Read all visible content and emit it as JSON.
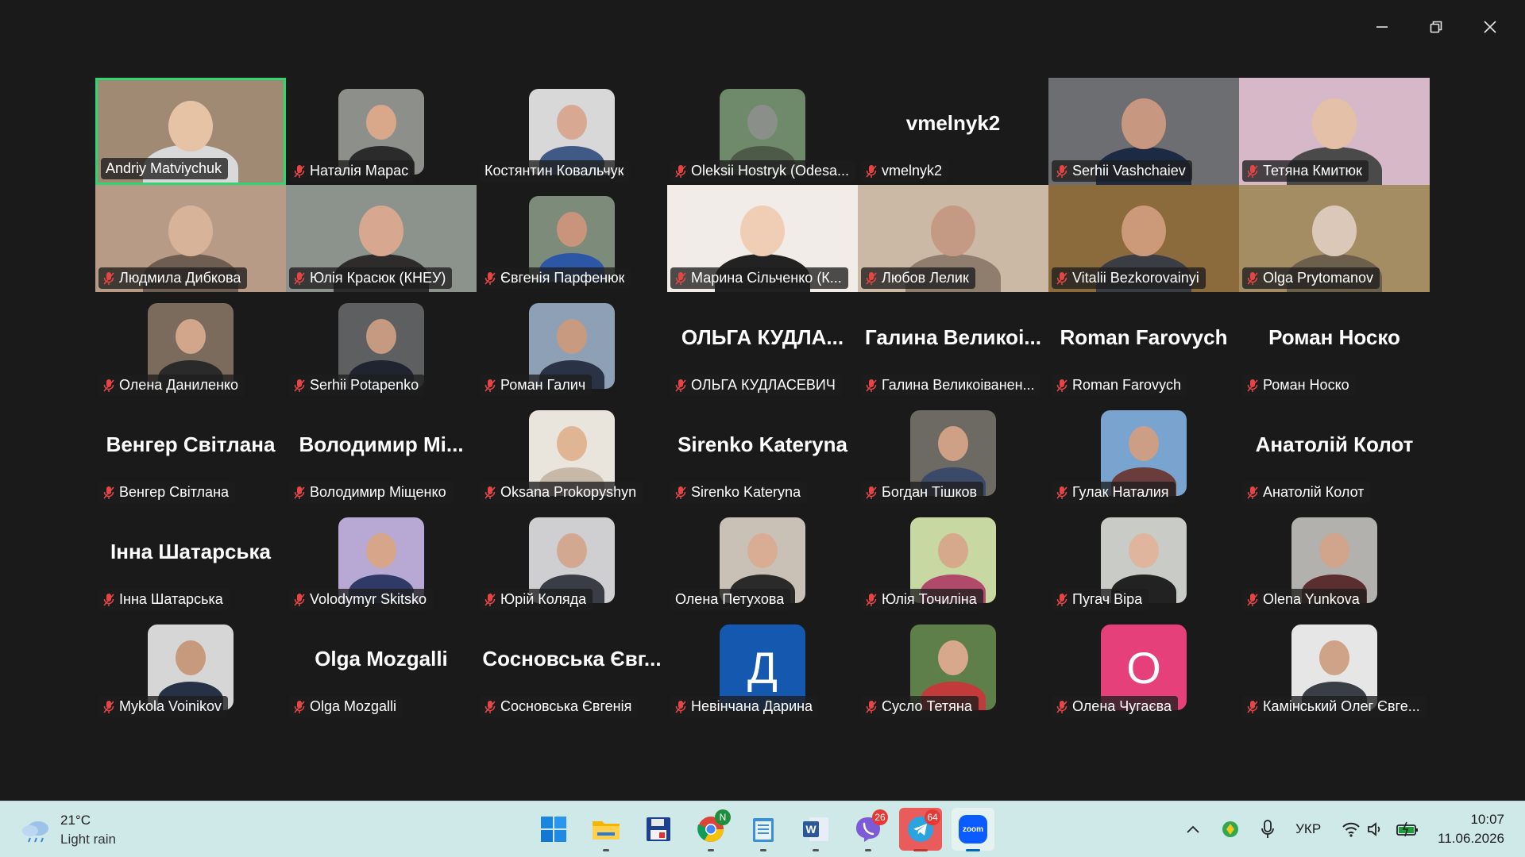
{
  "window_controls": {
    "minimize": "minimize",
    "restore": "restore",
    "close": "close"
  },
  "participants": [
    {
      "name": "Andriy Matviychuk",
      "mode": "full",
      "active": true,
      "muted": false,
      "bg": "#a08a74",
      "skin": "#e6c3a4",
      "shirt": "#d9d9d9"
    },
    {
      "name": "Наталія Марас",
      "mode": "thumb",
      "muted": true,
      "bg": "#8d8f8a",
      "skin": "#d9a88a",
      "shirt": "#2b2b2b"
    },
    {
      "name": "Костянтин Ковальчук",
      "mode": "thumb",
      "muted": false,
      "bg": "#d8d8d8",
      "skin": "#d9a892",
      "shirt": "#3f5a84"
    },
    {
      "name": "Oleksii Hostryk (Odesa...",
      "mode": "thumb",
      "muted": true,
      "bg": "#6f8a6a",
      "skin": "#8a8f8a",
      "shirt": "#4d5a48"
    },
    {
      "name": "vmelnyk2",
      "big": "vmelnyk2",
      "mode": "text",
      "muted": true
    },
    {
      "name": "Serhii Vashchaiev",
      "mode": "full",
      "muted": true,
      "bg": "#6d6e72",
      "skin": "#c89780",
      "shirt": "#1c2a44"
    },
    {
      "name": "Тетяна Кмитюк",
      "mode": "full",
      "muted": true,
      "bg": "#d7b8c9",
      "skin": "#e4c0a8",
      "shirt": "#4a4a4a"
    },
    {
      "name": "Людмила Дибкова",
      "mode": "full",
      "muted": true,
      "bg": "#b89b86",
      "skin": "#d7b39a",
      "shirt": "#6e5e52"
    },
    {
      "name": "Юлія Красюк (КНЕУ)",
      "mode": "full",
      "muted": true,
      "bg": "#8c938d",
      "skin": "#d7a88f",
      "shirt": "#2e2b2b"
    },
    {
      "name": "Євгенія Парфенюк",
      "mode": "thumb",
      "muted": true,
      "bg": "#7c8b7a",
      "skin": "#c8957c",
      "shirt": "#2b57a6"
    },
    {
      "name": "Марина Сільченко (К...",
      "mode": "full",
      "muted": true,
      "bg": "#f2ece8",
      "skin": "#f0cdb5",
      "shirt": "#222"
    },
    {
      "name": "Любов Лелик",
      "mode": "full",
      "muted": true,
      "bg": "#cbb8a5",
      "skin": "#c49a84",
      "shirt": "#8f7d6d"
    },
    {
      "name": "Vitalii Bezkorovainyi",
      "mode": "full",
      "muted": true,
      "bg": "#8b6a3b",
      "skin": "#cc9a78",
      "shirt": "#3b3d44"
    },
    {
      "name": "Olga Prytomanov",
      "mode": "full",
      "muted": true,
      "bg": "#a48d63",
      "skin": "#dcc8b8",
      "shirt": "#6c5f4c"
    },
    {
      "name": "Олена Даниленко",
      "mode": "thumb",
      "muted": true,
      "bg": "#7a6b5c",
      "skin": "#d2a68a",
      "shirt": "#2a2a2a"
    },
    {
      "name": "Serhii Potapenko",
      "mode": "thumb",
      "muted": true,
      "bg": "#5e5f60",
      "skin": "#c69a80",
      "shirt": "#1f2430"
    },
    {
      "name": "Роман Галич",
      "mode": "thumb",
      "muted": true,
      "bg": "#8ea0b6",
      "skin": "#c89a80",
      "shirt": "#2a3346"
    },
    {
      "name": "ОЛЬГА КУДЛАСЕВИЧ",
      "big": "ОЛЬГА КУДЛА...",
      "mode": "text",
      "muted": true
    },
    {
      "name": "Галина Великоіванен...",
      "big": "Галина Великоі...",
      "mode": "text",
      "muted": true
    },
    {
      "name": "Roman Farovych",
      "big": "Roman Farovych",
      "mode": "text",
      "muted": true
    },
    {
      "name": "Роман Носко",
      "big": "Роман Носко",
      "mode": "text",
      "muted": true
    },
    {
      "name": "Венгер Світлана",
      "big": "Венгер Світлана",
      "mode": "text",
      "muted": true
    },
    {
      "name": "Володимир Міщенко",
      "big": "Володимир Мі...",
      "mode": "text",
      "muted": true
    },
    {
      "name": "Oksana Prokopyshyn",
      "mode": "thumb",
      "muted": true,
      "bg": "#e9e4dc",
      "skin": "#e0b594",
      "shirt": "#c7b8a8"
    },
    {
      "name": "Sirenko Kateryna",
      "big": "Sirenko Kateryna",
      "mode": "text",
      "muted": true
    },
    {
      "name": "Богдан Тішков",
      "mode": "thumb",
      "muted": true,
      "bg": "#6d6a64",
      "skin": "#cfa085",
      "shirt": "#3c4a6a"
    },
    {
      "name": "Гулак Наталия",
      "mode": "thumb",
      "muted": true,
      "bg": "#79a4cf",
      "skin": "#cd9e86",
      "shirt": "#6a3c3c"
    },
    {
      "name": "Анатолій Колот",
      "big": "Анатолій Колот",
      "mode": "text",
      "muted": true
    },
    {
      "name": "Інна Шатарська",
      "big": "Інна Шатарська",
      "mode": "text",
      "muted": true
    },
    {
      "name": "Volodymyr Skitsko",
      "mode": "thumb",
      "muted": true,
      "bg": "#b7a9d4",
      "skin": "#d6a58a",
      "shirt": "#2f3a66"
    },
    {
      "name": "Юрій Коляда",
      "mode": "thumb",
      "muted": true,
      "bg": "#cfcfd2",
      "skin": "#d3a891",
      "shirt": "#3a3d45"
    },
    {
      "name": "Олена Петухова",
      "mode": "thumb",
      "muted": false,
      "bg": "#c9c1b5",
      "skin": "#d9ad93",
      "shirt": "#2a2a2a"
    },
    {
      "name": "Юлія Точиліна",
      "mode": "thumb",
      "muted": true,
      "bg": "#c7d8a3",
      "skin": "#d7a98c",
      "shirt": "#b04a6a"
    },
    {
      "name": "Пугач Віра",
      "mode": "thumb",
      "muted": true,
      "bg": "#c8cbc6",
      "skin": "#e0b59d",
      "shirt": "#222"
    },
    {
      "name": "Olena Yunkova",
      "mode": "thumb",
      "muted": true,
      "bg": "#b3b1ad",
      "skin": "#d0a58c",
      "shirt": "#5b2f2f"
    },
    {
      "name": "Mykola Voinikov",
      "mode": "thumb",
      "muted": true,
      "bg": "#d6d6d6",
      "skin": "#c79a7e",
      "shirt": "#263146"
    },
    {
      "name": "Olga Mozgalli",
      "big": "Olga Mozgalli",
      "mode": "text",
      "muted": true
    },
    {
      "name": "Сосновська Євгенія",
      "big": "Сосновська Євг...",
      "mode": "text",
      "muted": true
    },
    {
      "name": "Невінчана Дарина",
      "mode": "letter",
      "letter": "Д",
      "color": "#1558b0",
      "muted": true
    },
    {
      "name": "Сусло Тетяна",
      "mode": "thumb",
      "muted": true,
      "bg": "#5f7f4a",
      "skin": "#d8a88c",
      "shirt": "#c23a3a"
    },
    {
      "name": "Олена Чугаєва",
      "mode": "letter",
      "letter": "О",
      "color": "#e6407a",
      "muted": true
    },
    {
      "name": "Камінський Олег Євге...",
      "mode": "thumb",
      "muted": true,
      "bg": "#e6e6e6",
      "skin": "#cfa388",
      "shirt": "#3a3e46"
    }
  ],
  "taskbar": {
    "weather_temp": "21°C",
    "weather_cond": "Light rain",
    "apps": [
      {
        "id": "start",
        "icon": "windows-start-icon"
      },
      {
        "id": "explorer",
        "icon": "file-explorer-icon"
      },
      {
        "id": "save",
        "icon": "floppy-disk-icon"
      },
      {
        "id": "chrome",
        "icon": "chrome-icon",
        "badge": "N"
      },
      {
        "id": "notepad",
        "icon": "notepad-icon"
      },
      {
        "id": "word",
        "icon": "word-icon"
      },
      {
        "id": "viber",
        "icon": "viber-icon",
        "badge": "26"
      },
      {
        "id": "telegram",
        "icon": "telegram-icon",
        "badge": "64"
      },
      {
        "id": "zoom",
        "icon": "zoom-icon",
        "label": "zoom"
      }
    ],
    "language": "УКР",
    "time": "10:07",
    "date": "11.06.2026"
  }
}
